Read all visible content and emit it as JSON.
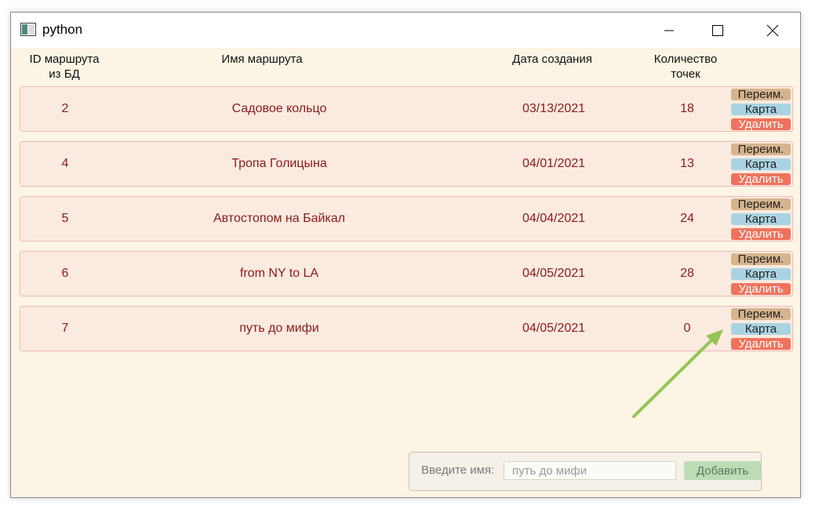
{
  "window": {
    "title": "python"
  },
  "headers": {
    "id_line1": "ID маршрута",
    "id_line2": "из БД",
    "name": "Имя маршрута",
    "date": "Дата создания",
    "count_line1": "Количество",
    "count_line2": "точек"
  },
  "actions": {
    "rename": "Переим.",
    "map": "Карта",
    "delete": "Удалить"
  },
  "routes": [
    {
      "id": "2",
      "name": "Садовое кольцо",
      "date": "03/13/2021",
      "points": "18"
    },
    {
      "id": "4",
      "name": "Тропа Голицына",
      "date": "04/01/2021",
      "points": "13"
    },
    {
      "id": "5",
      "name": "Автостопом на Байкал",
      "date": "04/04/2021",
      "points": "24"
    },
    {
      "id": "6",
      "name": "from NY to LA",
      "date": "04/05/2021",
      "points": "28"
    },
    {
      "id": "7",
      "name": "путь до мифи",
      "date": "04/05/2021",
      "points": "0"
    }
  ],
  "add_form": {
    "label": "Введите имя:",
    "value": "",
    "placeholder": "путь до мифи",
    "button": "Добавить"
  },
  "colors": {
    "window_bg": "#fcf4e4",
    "row_bg": "#faeadf",
    "row_text": "#8b1a1a",
    "rename_btn": "#d6b48c",
    "map_btn": "#a9d3e3",
    "delete_btn": "#f0725c",
    "add_btn": "#bcdcb6",
    "annotation_arrow": "#94c454"
  }
}
